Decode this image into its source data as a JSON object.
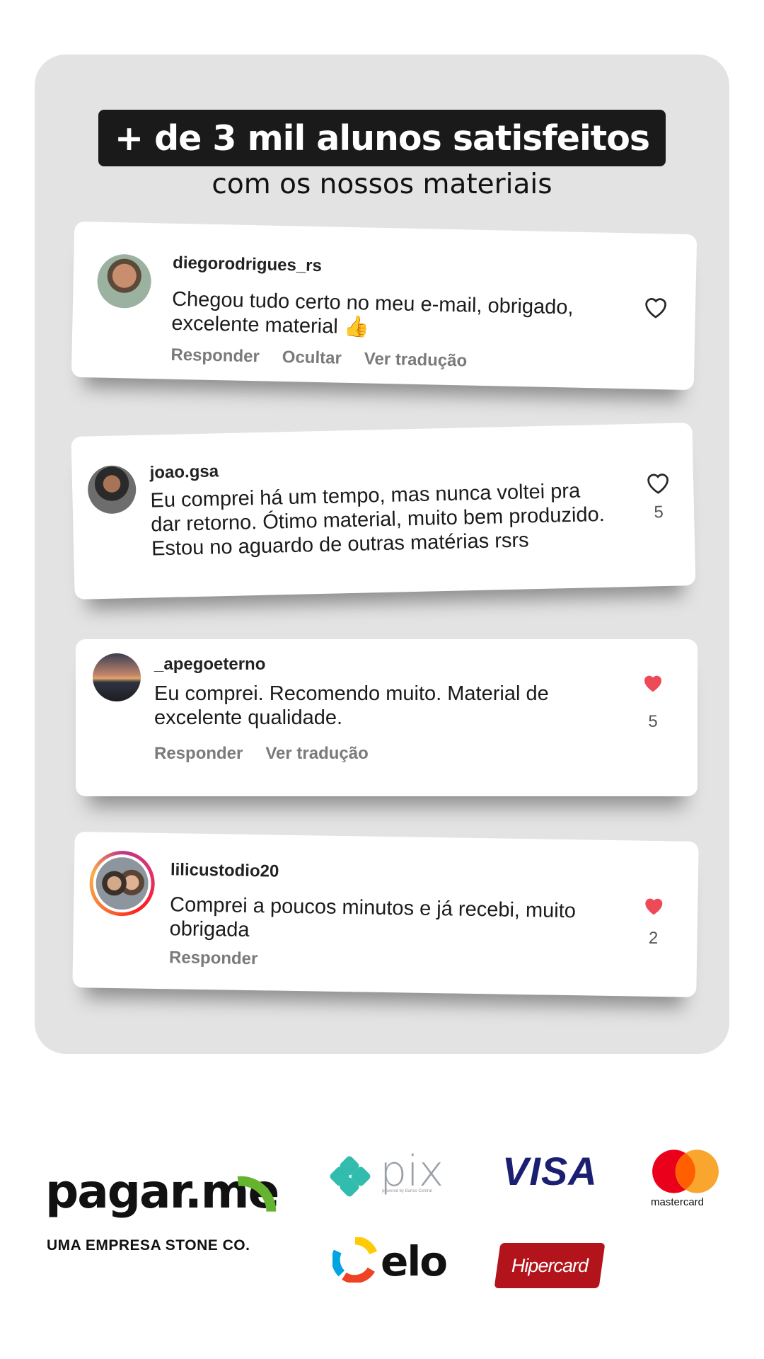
{
  "headline": "+ de 3 mil alunos satisfeitos",
  "subheadline": "com os nossos materiais",
  "comments": [
    {
      "username": "diegorodrigues_rs",
      "text": "Chegou tudo certo no meu e-mail, obrigado, excelente material 👍",
      "actions": [
        "Responder",
        "Ocultar",
        "Ver tradução"
      ],
      "liked": false,
      "likes": ""
    },
    {
      "username": "joao.gsa",
      "text": "Eu comprei há um tempo, mas nunca voltei pra dar retorno. Ótimo material, muito bem produzido. Estou no aguardo de outras matérias rsrs",
      "actions": [],
      "liked": false,
      "likes": "5"
    },
    {
      "username": "_apegoeterno",
      "text": "Eu comprei. Recomendo muito. Material de excelente qualidade.",
      "actions": [
        "Responder",
        "Ver tradução"
      ],
      "liked": true,
      "likes": "5"
    },
    {
      "username": "lilicustodio20",
      "text": "Comprei a poucos minutos e já recebi, muito obrigada",
      "actions": [
        "Responder"
      ],
      "liked": true,
      "likes": "2"
    }
  ],
  "payment": {
    "provider_name": "pagar.me",
    "provider_tagline": "UMA EMPRESA STONE CO.",
    "pix_label": "pix",
    "pix_sub": "powered by Banco Central",
    "visa_label": "VISA",
    "mastercard_label": "mastercard",
    "elo_label": "elo",
    "hipercard_label": "Hipercard"
  },
  "colors": {
    "heart_liked": "#ed4956",
    "heart_outline": "#262626",
    "panel_bg": "#e3e3e3",
    "pagarme_green": "#65b32e",
    "pix_teal": "#32bcad",
    "visa_blue": "#1a1f71",
    "mastercard_red": "#eb001b",
    "mastercard_orange": "#f79e1b",
    "hipercard_red": "#b3131b"
  }
}
